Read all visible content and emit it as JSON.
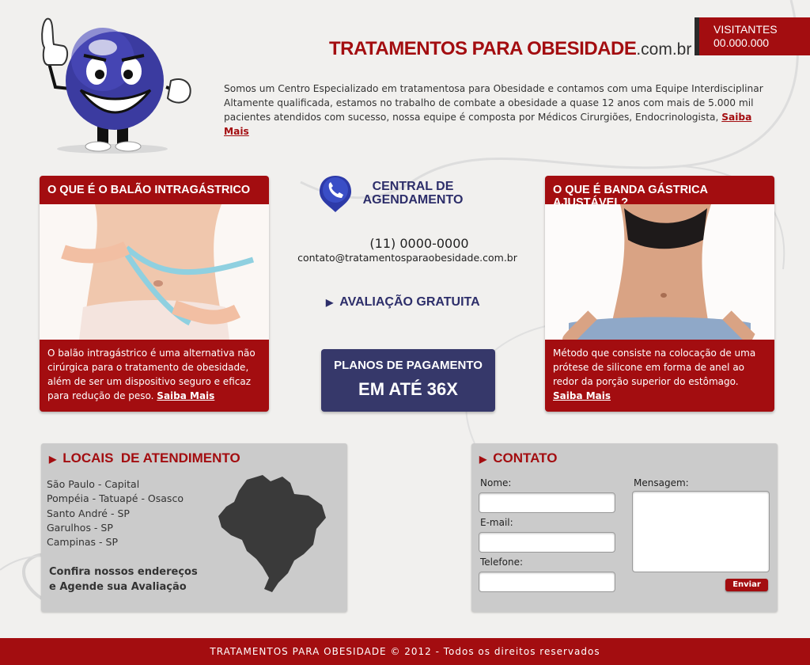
{
  "header": {
    "title_main": "TRATAMENTOS PARA OBESIDADE",
    "title_domain": ".com.br",
    "visitors_label": "VISITANTES",
    "visitors_count": "00.000.000",
    "intro_text": "Somos um Centro Especializado em tratamentosa para Obesidade e contamos com uma Equipe Interdisciplinar Altamente qualificada, estamos no trabalho de combate a obesidade a quase 12 anos com mais de 5.000 mil pacientes atendidos com sucesso, nossa equipe é composta por Médicos Cirurgiões, Endocrinologista,",
    "intro_link": "Saiba Mais"
  },
  "card_left": {
    "title": "O QUE É O BALÃO INTRAGÁSTRICO",
    "text": "O balão intragástrico é uma alternativa não cirúrgica para o tratamento de obesidade, além de ser um dispositivo seguro e eficaz para redução de peso.",
    "link": "Saiba Mais"
  },
  "card_right": {
    "title": "O QUE É BANDA GÁSTRICA AJUSTÁVEL?",
    "text": "Método que consiste na colocação de uma prótese de silicone em forma de anel ao redor da porção superior do estômago.",
    "link": "Saiba Mais"
  },
  "central": {
    "title_line1": "CENTRAL DE",
    "title_line2": "AGENDAMENTO",
    "phone": "(11) 0000-0000",
    "email": "contato@tratamentosparaobesidade.com.br",
    "avaliacao": "AVALIAÇÃO GRATUITA",
    "planos_label": "PLANOS DE PAGAMENTO",
    "planos_value": "EM ATÉ 36X"
  },
  "locais": {
    "title": "LOCAIS  DE ATENDIMENTO",
    "items": [
      "São Paulo - Capital",
      "Pompéia - Tatuapé - Osasco",
      "Santo André - SP",
      "Garulhos - SP",
      "Campinas - SP"
    ],
    "cta_line1": "Confira nossos endereços",
    "cta_line2": "e Agende sua Avaliação"
  },
  "contato": {
    "title": "CONTATO",
    "nome_label": "Nome:",
    "email_label": "E-mail:",
    "telefone_label": "Telefone:",
    "mensagem_label": "Mensagem:",
    "submit_label": "Enviar"
  },
  "footer": {
    "text": "TRATAMENTOS PARA OBESIDADE © 2012 - Todos os direitos reservados"
  },
  "colors": {
    "brand_red": "#a30d10",
    "navy": "#36386a",
    "panel_gray": "#cbcbcb"
  }
}
